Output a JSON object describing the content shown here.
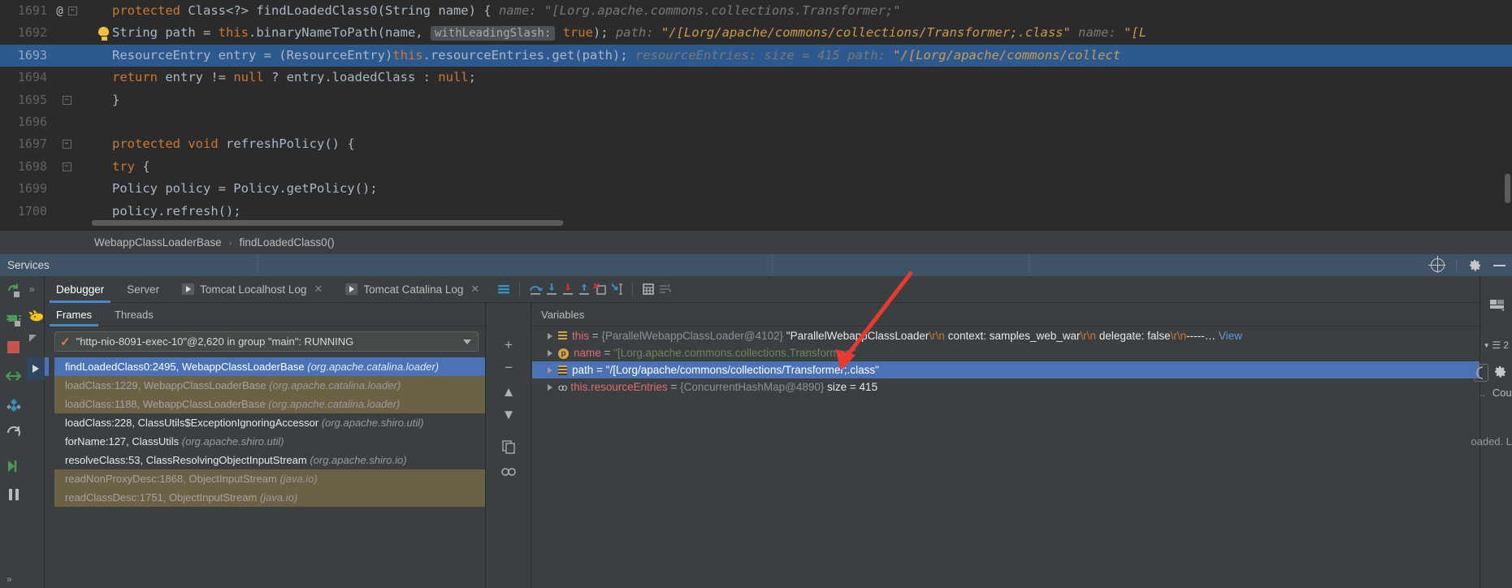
{
  "editor": {
    "lines": [
      {
        "no": "1691",
        "gutter": "@",
        "fold": "minus",
        "segments": [
          {
            "t": "protected ",
            "c": "kw"
          },
          {
            "t": "Class<?> ",
            "c": "plain"
          },
          {
            "t": "findLoadedClass0",
            "c": "plain"
          },
          {
            "t": "(",
            "c": "plain"
          },
          {
            "t": "String ",
            "c": "plain"
          },
          {
            "t": "name",
            "c": "plain"
          },
          {
            "t": ") {",
            "c": "plain"
          },
          {
            "t": "   name:  ",
            "c": "hint"
          },
          {
            "t": "\"[Lorg.apache.commons.collections.Transformer;\"",
            "c": "hint"
          }
        ]
      },
      {
        "no": "1692",
        "gutter": "",
        "fold": "",
        "segments": [
          {
            "t": "    String path = ",
            "c": "plain"
          },
          {
            "t": "this",
            "c": "kw"
          },
          {
            "t": ".binaryNameToPath(name, ",
            "c": "plain"
          },
          {
            "t": "withLeadingSlash:",
            "c": "paramhint"
          },
          {
            "t": " ",
            "c": "plain"
          },
          {
            "t": "true",
            "c": "kw"
          },
          {
            "t": ");",
            "c": "plain"
          },
          {
            "t": "  path:  ",
            "c": "hint"
          },
          {
            "t": "\"/[Lorg/apache/commons/collections/Transformer;.class\"",
            "c": "hint-str"
          },
          {
            "t": "   name:  ",
            "c": "hint"
          },
          {
            "t": "\"[L",
            "c": "hint-str"
          }
        ]
      },
      {
        "no": "1693",
        "gutter": "",
        "fold": "",
        "highlight": true,
        "segments": [
          {
            "t": "    ResourceEntry entry = (ResourceEntry)",
            "c": "plain"
          },
          {
            "t": "this",
            "c": "kw"
          },
          {
            "t": ".resourceEntries.get(path);",
            "c": "plain"
          },
          {
            "t": "   resourceEntries:   size = 415",
            "c": "hint"
          },
          {
            "t": "  path:  ",
            "c": "hint"
          },
          {
            "t": "\"/[Lorg/apache/commons/collect",
            "c": "hint-str"
          }
        ]
      },
      {
        "no": "1694",
        "gutter": "",
        "fold": "",
        "segments": [
          {
            "t": "    ",
            "c": "plain"
          },
          {
            "t": "return ",
            "c": "kw"
          },
          {
            "t": "entry != ",
            "c": "plain"
          },
          {
            "t": "null",
            "c": "kw"
          },
          {
            "t": " ? entry.loadedClass : ",
            "c": "plain"
          },
          {
            "t": "null",
            "c": "kw"
          },
          {
            "t": ";",
            "c": "plain"
          }
        ]
      },
      {
        "no": "1695",
        "gutter": "",
        "fold": "minus",
        "segments": [
          {
            "t": "}",
            "c": "plain"
          }
        ]
      },
      {
        "no": "1696",
        "gutter": "",
        "fold": "",
        "segments": []
      },
      {
        "no": "1697",
        "gutter": "",
        "fold": "minus",
        "segments": [
          {
            "t": "protected ",
            "c": "kw"
          },
          {
            "t": "void ",
            "c": "kw"
          },
          {
            "t": "refreshPolicy",
            "c": "plain"
          },
          {
            "t": "() {",
            "c": "plain"
          }
        ]
      },
      {
        "no": "1698",
        "gutter": "",
        "fold": "minus",
        "segments": [
          {
            "t": "    ",
            "c": "plain"
          },
          {
            "t": "try",
            "c": "kw"
          },
          {
            "t": " {",
            "c": "plain"
          }
        ]
      },
      {
        "no": "1699",
        "gutter": "",
        "fold": "",
        "segments": [
          {
            "t": "        Policy policy = Policy.getPolicy();",
            "c": "plain"
          }
        ]
      },
      {
        "no": "1700",
        "gutter": "",
        "fold": "",
        "segments": [
          {
            "t": "        policy.refresh();",
            "c": "plain"
          }
        ]
      }
    ]
  },
  "breadcrumb": {
    "class": "WebappClassLoaderBase",
    "separator": "›",
    "method": "findLoadedClass0()"
  },
  "services": {
    "title": "Services"
  },
  "debug_tabs": [
    {
      "label": "Debugger",
      "active": true,
      "icon": null,
      "closable": false
    },
    {
      "label": "Server",
      "active": false,
      "icon": null,
      "closable": false
    },
    {
      "label": "Tomcat Localhost Log",
      "active": false,
      "icon": "play-icon",
      "closable": true
    },
    {
      "label": "Tomcat Catalina Log",
      "active": false,
      "icon": "play-icon",
      "closable": true
    }
  ],
  "debug_toolbar_icons": [
    "mute-breakpoints-icon",
    "step-over-icon",
    "step-into-icon",
    "force-step-into-icon",
    "step-out-icon",
    "drop-frame-icon",
    "run-to-cursor-icon",
    "evaluate-expression-icon",
    "layout-icon"
  ],
  "frames": {
    "tabs": [
      {
        "label": "Frames",
        "active": true
      },
      {
        "label": "Threads",
        "active": false
      }
    ],
    "thread": "\"http-nio-8091-exec-10\"@2,620 in group \"main\": RUNNING",
    "rows": [
      {
        "main": "findLoadedClass0:2495, WebappClassLoaderBase",
        "pkg": "(org.apache.catalina.loader)",
        "state": "selected"
      },
      {
        "main": "loadClass:1229, WebappClassLoaderBase",
        "pkg": "(org.apache.catalina.loader)",
        "state": "lib"
      },
      {
        "main": "loadClass:1188, WebappClassLoaderBase",
        "pkg": "(org.apache.catalina.loader)",
        "state": "lib"
      },
      {
        "main": "loadClass:228, ClassUtils$ExceptionIgnoringAccessor",
        "pkg": "(org.apache.shiro.util)",
        "state": "bright"
      },
      {
        "main": "forName:127, ClassUtils",
        "pkg": "(org.apache.shiro.util)",
        "state": "bright"
      },
      {
        "main": "resolveClass:53, ClassResolvingObjectInputStream",
        "pkg": "(org.apache.shiro.io)",
        "state": "bright"
      },
      {
        "main": "readNonProxyDesc:1868, ObjectInputStream",
        "pkg": "(java.io)",
        "state": "lib"
      },
      {
        "main": "readClassDesc:1751, ObjectInputStream",
        "pkg": "(java.io)",
        "state": "lib"
      }
    ]
  },
  "variables": {
    "header": "Variables",
    "rows": [
      {
        "icon": "field-icon",
        "arrow": "right",
        "name": "this",
        "eq": " = ",
        "obj": "{ParallelWebappClassLoader@4102}",
        "value_white": "\"ParallelWebappClassLoader",
        "esc1": "\\r\\n",
        "mid": "  context: samples_web_war",
        "esc2": "\\r\\n",
        "mid2": "  delegate: false",
        "esc3": "\\r\\n",
        "tail": "-----… ",
        "link": "View",
        "selected": false
      },
      {
        "icon": "param-icon",
        "arrow": "right",
        "name": "name",
        "eq": " = ",
        "str": "\"[Lorg.apache.commons.collections.Transformer;\"",
        "selected": false
      },
      {
        "icon": "field-icon",
        "arrow": "right",
        "name": "path",
        "eq": " = ",
        "str": "\"/[Lorg/apache/commons/collections/Transformer;.class\"",
        "selected": true
      },
      {
        "icon": "chain-icon",
        "arrow": "right",
        "name": "this.resourceEntries",
        "eq": " = ",
        "obj": "{ConcurrentHashMap@4890}",
        "size": "size = 415",
        "selected": false
      }
    ]
  },
  "right_panel": {
    "count_label": "Cou",
    "loaded_text": "oaded. L",
    "badge_count": "2",
    "ellipsis": ".."
  },
  "colors": {
    "accent_blue": "#4a88c7",
    "selection_blue": "#4a72b5",
    "editor_highlight": "#2d5a8e",
    "lib_frame": "#6b6246",
    "keyword_orange": "#cc7832",
    "string_green": "#6a8759",
    "annotation_red": "#e83b2f"
  }
}
